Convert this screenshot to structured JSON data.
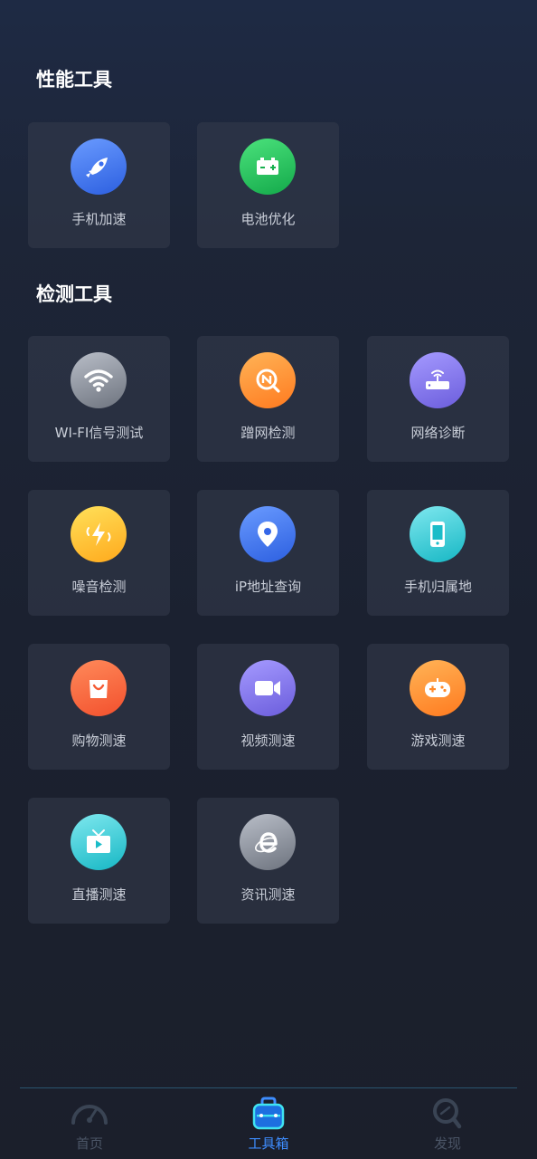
{
  "sections": [
    {
      "title": "性能工具"
    },
    {
      "title": "检测工具"
    }
  ],
  "tools": [
    {
      "label": "手机加速",
      "icon": "rocket-icon"
    },
    {
      "label": "电池优化",
      "icon": "battery-icon"
    },
    {
      "label": "WI-FI信号测试",
      "icon": "wifi-icon"
    },
    {
      "label": "蹭网检测",
      "icon": "network-search-icon"
    },
    {
      "label": "网络诊断",
      "icon": "router-icon"
    },
    {
      "label": "噪音检测",
      "icon": "noise-icon"
    },
    {
      "label": "iP地址查询",
      "icon": "location-pin-icon"
    },
    {
      "label": "手机归属地",
      "icon": "phone-icon"
    },
    {
      "label": "购物测速",
      "icon": "shopping-bag-icon"
    },
    {
      "label": "视频测速",
      "icon": "video-camera-icon"
    },
    {
      "label": "游戏测速",
      "icon": "gamepad-icon"
    },
    {
      "label": "直播测速",
      "icon": "tv-play-icon"
    },
    {
      "label": "资讯测速",
      "icon": "browser-e-icon"
    }
  ],
  "tabbar": {
    "items": [
      {
        "label": "首页",
        "icon": "speedometer-icon",
        "active": false
      },
      {
        "label": "工具箱",
        "icon": "toolbox-icon",
        "active": true
      },
      {
        "label": "发现",
        "icon": "discover-search-icon",
        "active": false
      }
    ]
  },
  "colors": {
    "active_tab": "#3e8dff",
    "inactive_tab": "#4b5566",
    "card_bg": "#2b3242"
  }
}
